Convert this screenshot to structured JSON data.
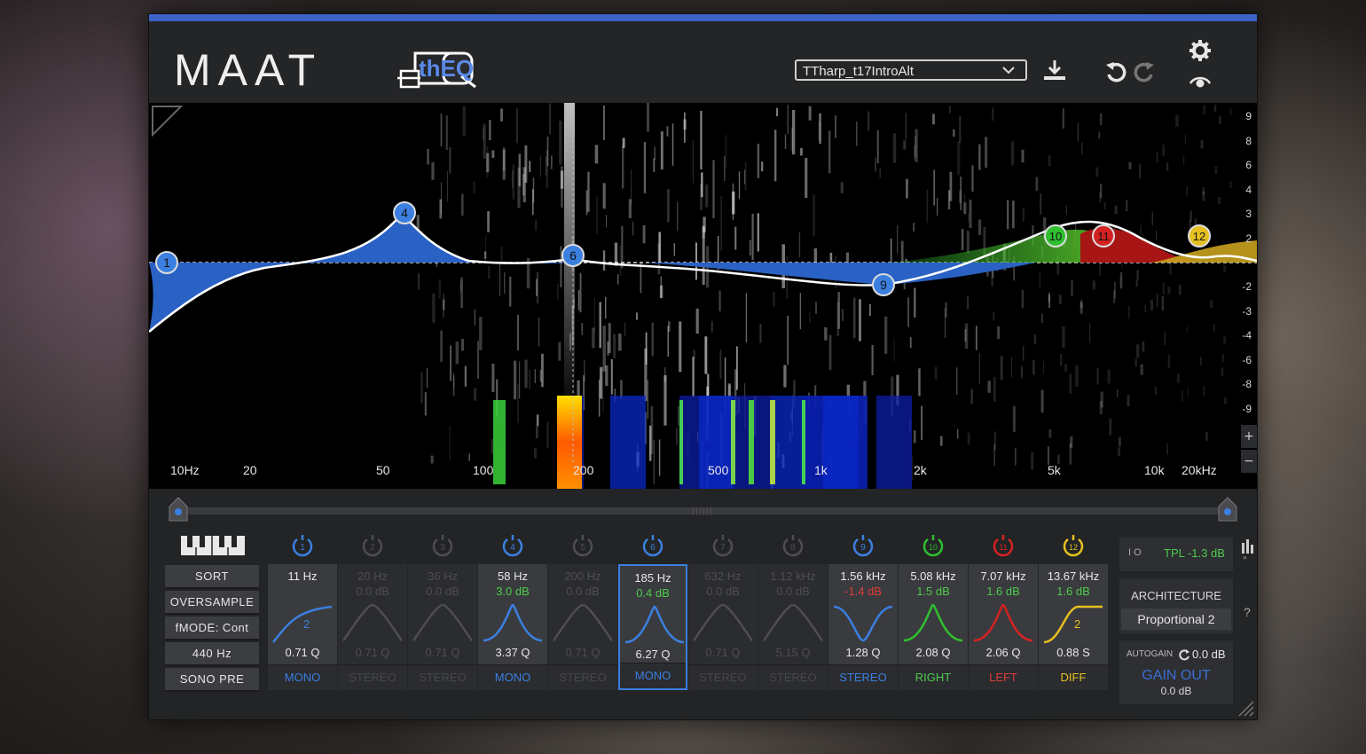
{
  "header": {
    "brand": "MAAT",
    "product": "thEQ",
    "preset": "TTharp_t17IntroAlt"
  },
  "colors": {
    "accent": "#3d63c8",
    "band_blue": "#3b7fe0",
    "band_green": "#2fbf2f",
    "band_red": "#d42222",
    "band_yellow": "#e5c020",
    "gain_red": "#e03b3b",
    "gain_green": "#4ecb4e"
  },
  "display": {
    "freq_labels": [
      "10Hz",
      "20",
      "50",
      "100",
      "200",
      "500",
      "1k",
      "2k",
      "5k",
      "10k",
      "20kHz"
    ],
    "db_labels": [
      "9",
      "8",
      "6",
      "4",
      "3",
      "2",
      "-2",
      "-3",
      "-4",
      "-6",
      "-8",
      "-9"
    ],
    "nodes": [
      {
        "id": "1",
        "color": "blue"
      },
      {
        "id": "4",
        "color": "blue"
      },
      {
        "id": "6",
        "color": "blue"
      },
      {
        "id": "9",
        "color": "blue"
      },
      {
        "id": "10",
        "color": "green"
      },
      {
        "id": "11",
        "color": "red"
      },
      {
        "id": "12",
        "color": "yellow"
      }
    ],
    "zoom_in": "+",
    "zoom_out": "−"
  },
  "side_buttons": [
    "SORT",
    "OVERSAMPLE",
    "fMODE: Cont",
    "440 Hz",
    "SONO PRE"
  ],
  "bands": [
    {
      "num": "1",
      "freq": "11 Hz",
      "gain": "",
      "q": "0.71 Q",
      "mode": "MONO",
      "active": true,
      "shape": "hicut",
      "color": "blue",
      "label_num": "2"
    },
    {
      "num": "2",
      "freq": "20 Hz",
      "gain": "0.0 dB",
      "q": "0.71 Q",
      "mode": "STEREO",
      "active": false,
      "shape": "bell",
      "color": "grey"
    },
    {
      "num": "3",
      "freq": "36 Hz",
      "gain": "0.0 dB",
      "q": "0.71 Q",
      "mode": "STEREO",
      "active": false,
      "shape": "bell",
      "color": "grey"
    },
    {
      "num": "4",
      "freq": "58 Hz",
      "gain": "3.0 dB",
      "q": "3.37 Q",
      "mode": "MONO",
      "active": true,
      "shape": "bell",
      "color": "blue"
    },
    {
      "num": "5",
      "freq": "200 Hz",
      "gain": "0.0 dB",
      "q": "0.71 Q",
      "mode": "STEREO",
      "active": false,
      "shape": "bell",
      "color": "grey"
    },
    {
      "num": "6",
      "freq": "185 Hz",
      "gain": "0.4 dB",
      "q": "6.27 Q",
      "mode": "MONO",
      "active": true,
      "shape": "bell",
      "color": "blue",
      "selected": true
    },
    {
      "num": "7",
      "freq": "632 Hz",
      "gain": "0.0 dB",
      "q": "0.71 Q",
      "mode": "STEREO",
      "active": false,
      "shape": "bell",
      "color": "grey"
    },
    {
      "num": "8",
      "freq": "1.12 kHz",
      "gain": "0.0 dB",
      "q": "5.15 Q",
      "mode": "STEREO",
      "active": false,
      "shape": "bell",
      "color": "grey"
    },
    {
      "num": "9",
      "freq": "1.56 kHz",
      "gain": "-1.4 dB",
      "q": "1.28 Q",
      "mode": "STEREO",
      "active": true,
      "shape": "dip",
      "color": "blue"
    },
    {
      "num": "10",
      "freq": "5.08 kHz",
      "gain": "1.5 dB",
      "q": "2.08 Q",
      "mode": "RIGHT",
      "active": true,
      "shape": "bell",
      "color": "green"
    },
    {
      "num": "11",
      "freq": "7.07 kHz",
      "gain": "1.6 dB",
      "q": "2.06 Q",
      "mode": "LEFT",
      "active": true,
      "shape": "bell",
      "color": "red"
    },
    {
      "num": "12",
      "freq": "13.67 kHz",
      "gain": "1.6 dB",
      "q": "0.88 S",
      "mode": "DIFF",
      "active": true,
      "shape": "shelf",
      "color": "yellow",
      "label_num": "2"
    }
  ],
  "right_panel": {
    "tpl": "TPL -1.3 dB",
    "io_label": "I O",
    "architecture_label": "ARCHITECTURE",
    "architecture_value": "Proportional 2",
    "help": "?",
    "autogain_label": "AUTOGAIN",
    "autogain_value": "0.0 dB",
    "gain_out_label": "GAIN OUT",
    "gain_out_value": "0.0 dB"
  }
}
